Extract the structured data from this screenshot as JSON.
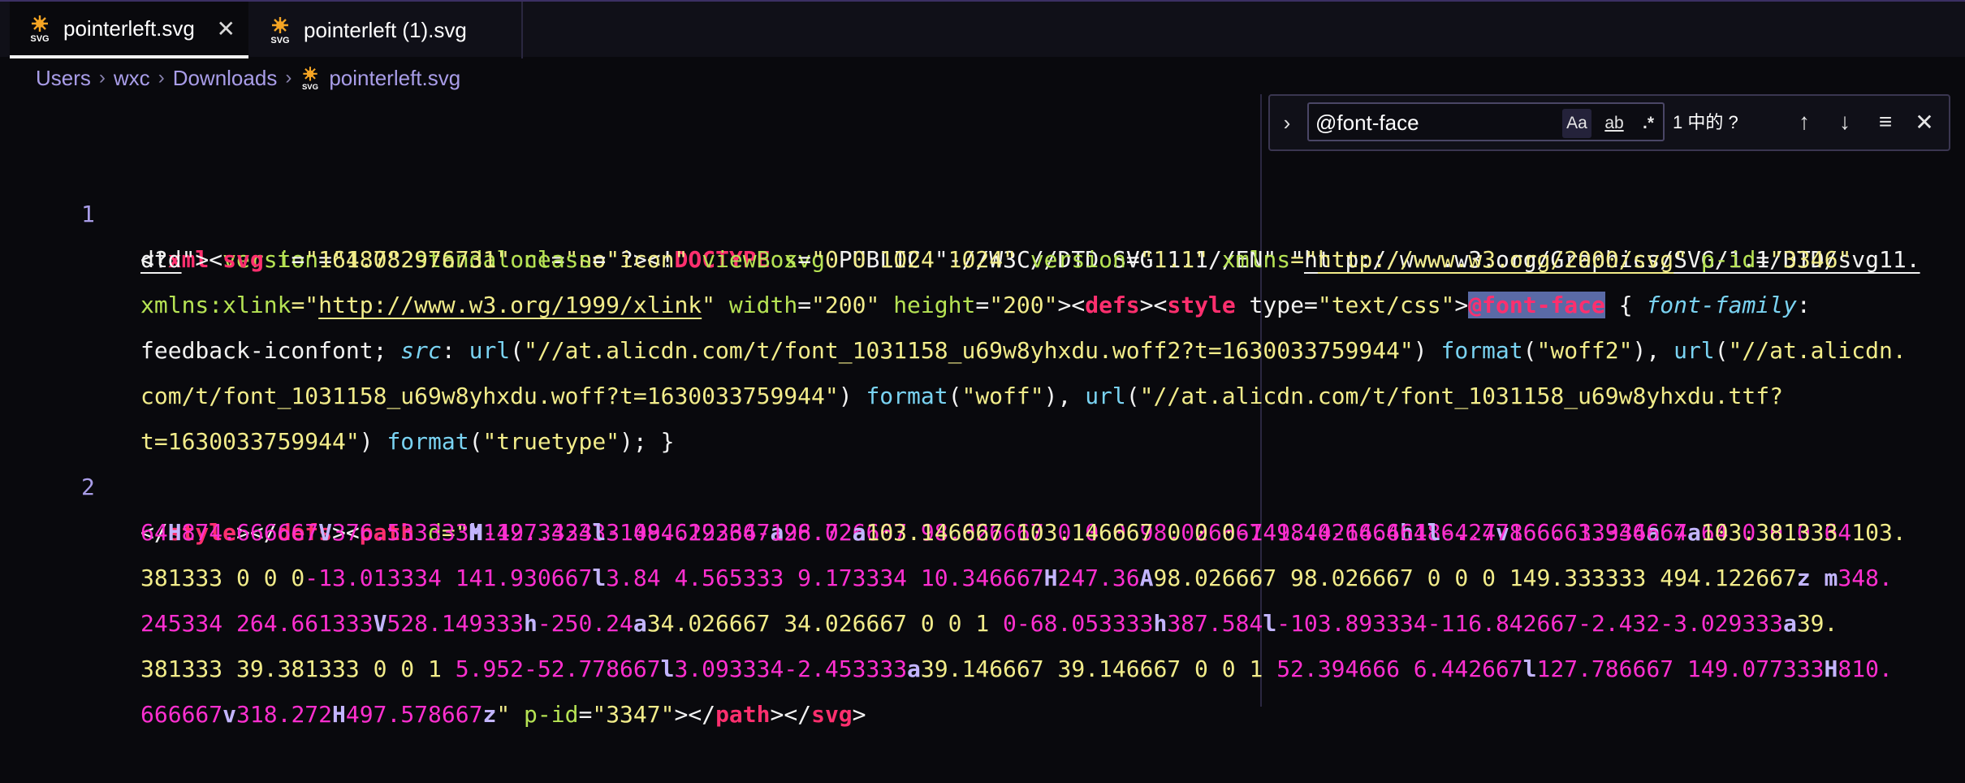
{
  "tabs": [
    {
      "label": "pointerleft.svg",
      "icon": "svg-file-icon",
      "close": "✕"
    },
    {
      "label": "pointerleft (1).svg",
      "icon": "svg-file-icon"
    }
  ],
  "file_icon_text": "SVG",
  "breadcrumb": {
    "items": [
      "Users",
      "wxc",
      "Downloads",
      "pointerleft.svg"
    ],
    "separator": "›"
  },
  "find": {
    "value": "@font-face",
    "toggle": "›",
    "match_case": "Aa",
    "whole_word": "ab",
    "regex": ".*",
    "count": "1 中的 ?",
    "prev": "↑",
    "next": "↓",
    "selection": "≡",
    "close": "✕"
  },
  "line_numbers": [
    "1",
    "2"
  ],
  "code": {
    "r1": [
      "<?",
      "xml",
      " ",
      "version",
      "=",
      "\"1.0\"",
      " ",
      "standalone",
      "=",
      "\"no\"",
      "?><!",
      "DOCTYPE",
      " ",
      "svg",
      " PUBLIC ",
      "\"-//W3C//DTD SVG 1.1//EN\"",
      " \"",
      "http://www.w3.org/Graphics/SVG/1.1/DTD/svg11."
    ],
    "r2": [
      "dtd",
      "\"><",
      "svg",
      " ",
      "t",
      "=",
      "\"1648782976731\"",
      " ",
      "class",
      "=",
      "\"icon\"",
      " ",
      "viewBox",
      "=",
      "\"0 0 1024 1024\"",
      " ",
      "version",
      "=",
      "\"1.1\"",
      " ",
      "xmlns",
      "=\"",
      "http://www.w3.org/2000/svg",
      "\"",
      " ",
      "p-id",
      "=",
      "\"3346\""
    ],
    "r3": [
      "xmlns:xlink",
      "=\"",
      "http://www.w3.org/1999/xlink",
      "\"",
      " ",
      "width",
      "=",
      "\"200\"",
      " ",
      "height",
      "=",
      "\"200\"",
      "><",
      "defs",
      "><",
      "style",
      " ",
      "type",
      "=",
      "\"text/css\"",
      ">",
      "@font-face",
      " { ",
      "font-family",
      ":"
    ],
    "r4": [
      "feedback-iconfont; ",
      "src",
      ": ",
      "url",
      "(",
      "\"//at.alicdn.com/t/font_1031158_u69w8yhxdu.woff2?t=1630033759944\"",
      ") ",
      "format",
      "(",
      "\"woff2\"",
      "), ",
      "url",
      "(",
      "\"//at.alicdn."
    ],
    "r5": [
      "com/t/font_1031158_u69w8yhxdu.woff?t=1630033759944\"",
      ") ",
      "format",
      "(",
      "\"woff\"",
      "), ",
      "url",
      "(",
      "\"//at.alicdn.com/t/font_1031158_u69w8yhxdu.ttf?"
    ],
    "r6": [
      "t=1630033759944\"",
      ") ",
      "format",
      "(",
      "\"truetype\"",
      "); }"
    ],
    "r7": [
      "</",
      "style",
      "></",
      "defs",
      "><",
      "path",
      " ",
      "d",
      "=\"",
      "M",
      "149.333333 494.122667",
      "a",
      "98.026667 98.026667 0 0 0 98.026667 98.026666",
      "h",
      "186.24",
      "v",
      "166.613334",
      "a",
      "64 64 0 0 0 64"
    ],
    "r8": [
      "64",
      "H",
      "874.666667",
      "V",
      "376.533333",
      "h",
      "-127.424",
      "l",
      "-108.629334-126.72",
      "a",
      "103.146667 103.146667 0 0 0",
      "-141.44-14.464",
      "l",
      "-4.778666 3.946667",
      "a",
      "103.381333 103."
    ],
    "r9": [
      "381333 0 0 0",
      "-13.013334 141.930667",
      "l",
      "3.84 4.565333 9.173334 10.346667",
      "H",
      "247.36",
      "A",
      "98.026667 98.026667 0 0 0 149.333333 494.122667",
      "z",
      " ",
      "m",
      "348."
    ],
    "r10": [
      "245334 264.661333",
      "V",
      "528.149333",
      "h",
      "-250.24",
      "a",
      "34.026667 34.026667 0 0 1 ",
      "0",
      "-68.053333",
      "h",
      "387.584",
      "l",
      "-103.893334-116.842667-2.432-3.029333",
      "a",
      "39."
    ],
    "r11": [
      "381333 39.381333 0 0 1 ",
      "5.952-52.778667",
      "l",
      "3.093334-2.453333",
      "a",
      "39.146667 39.146667 0 0 1 ",
      "52.394666 6.442667",
      "l",
      "127.786667 149.077333",
      "H",
      "810."
    ],
    "r12": [
      "666667",
      "v",
      "318.272",
      "H",
      "497.578667",
      "z",
      "\"",
      " ",
      "p-id",
      "=",
      "\"3347\"",
      "></",
      "path",
      "></",
      "svg",
      ">"
    ]
  }
}
